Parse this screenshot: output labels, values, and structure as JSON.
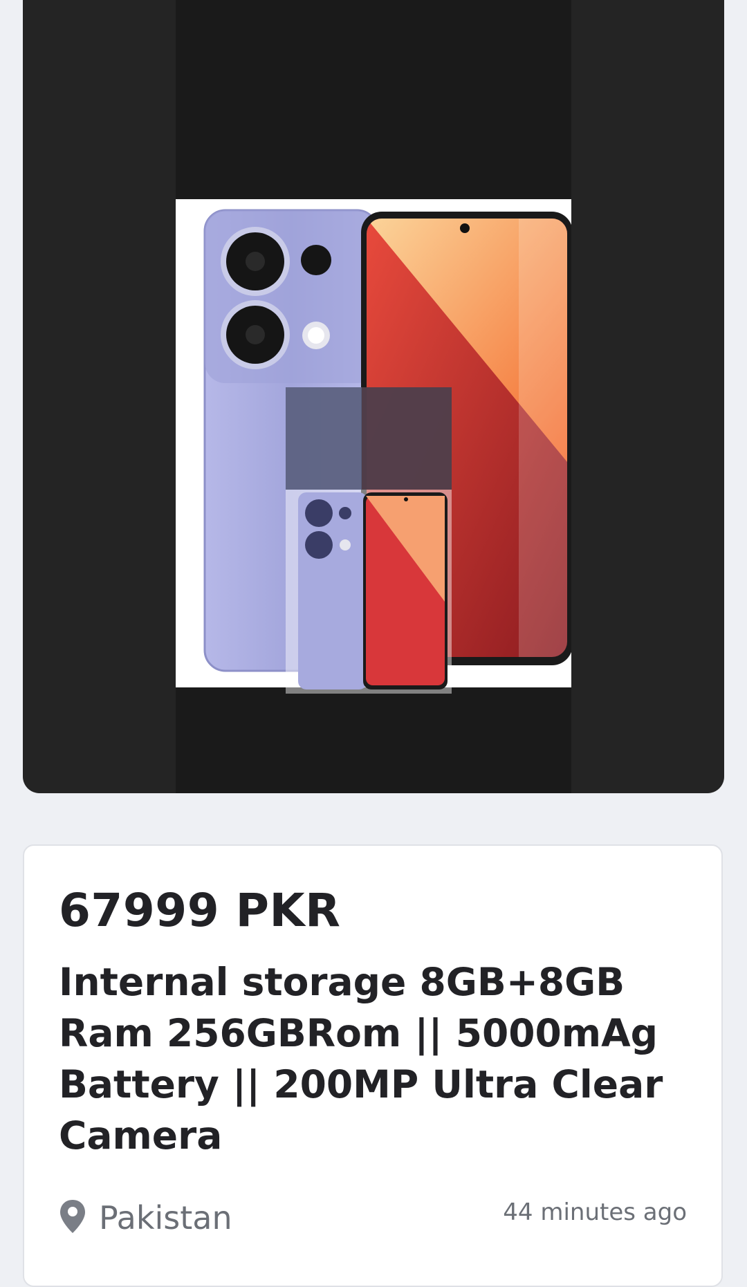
{
  "listing": {
    "price": "67999 PKR",
    "title": "Internal storage 8GB+8GB Ram 256GBRom || 5000mAg Battery || 200MP Ultra Clear Camera",
    "location": "Pakistan",
    "posted": "44 minutes ago"
  },
  "icons": {
    "location": "map-pin-icon"
  },
  "colors": {
    "page_bg": "#eef0f4",
    "gallery_bg": "#242424",
    "text_primary": "#222226",
    "text_secondary": "#6b6f76",
    "phone_back": "#a9abe0",
    "screen_red": "#c1272d",
    "screen_orange": "#f4a260"
  }
}
